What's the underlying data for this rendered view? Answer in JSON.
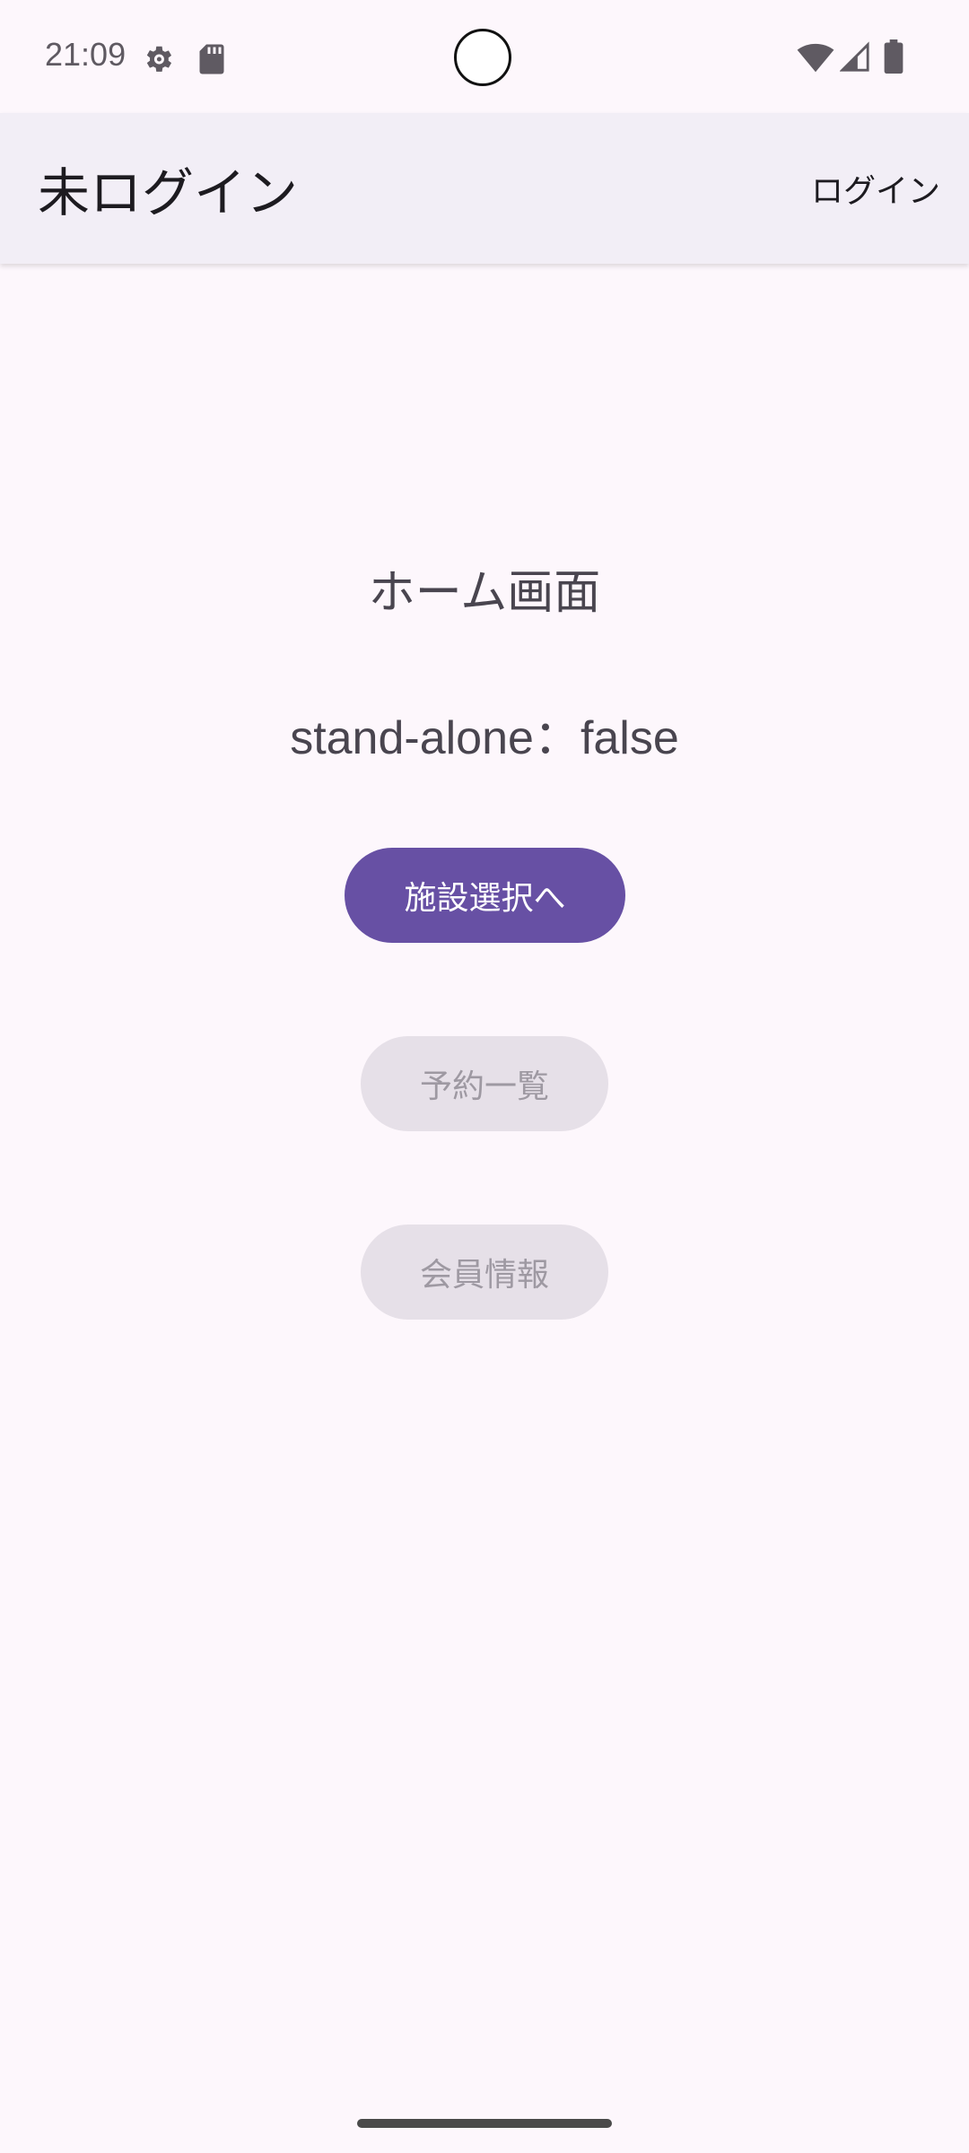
{
  "status_bar": {
    "time": "21:09",
    "icons": [
      "gear-icon",
      "sd-card-icon",
      "wifi-icon",
      "cell-signal-icon",
      "battery-icon"
    ]
  },
  "app_bar": {
    "title": "未ログイン",
    "login_action": "ログイン"
  },
  "main": {
    "screen_title": "ホーム画面",
    "standalone_status": "stand-alone：false",
    "buttons": {
      "facility_select": "施設選択へ",
      "reservation_list": "予約一覧",
      "member_info": "会員情報"
    }
  },
  "colors": {
    "background": "#fdf7fc",
    "app_bar": "#f2eef6",
    "primary": "#6750a4",
    "disabled_button": "#e6e0e8",
    "disabled_text": "#9e99a2"
  }
}
